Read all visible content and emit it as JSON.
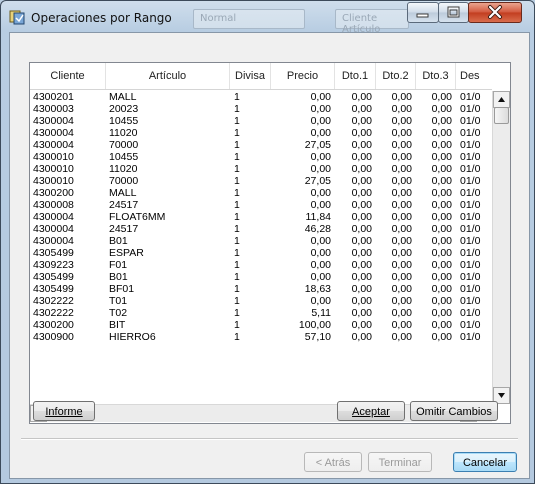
{
  "window": {
    "title": "Operaciones por Rango",
    "background_hint_1": "Normal",
    "background_hint_2": "Cliente Artículo"
  },
  "grid": {
    "columns": [
      "Cliente",
      "Artículo",
      "Divisa",
      "Precio",
      "Dto.1",
      "Dto.2",
      "Dto.3",
      "Desde"
    ],
    "columns_visible_text": [
      "Cliente",
      "Artículo",
      "Divisa",
      "Precio",
      "Dto.1",
      "Dto.2",
      "Dto.3",
      "Des"
    ],
    "rows": [
      [
        "4300201",
        "MALL",
        "1",
        "0,00",
        "0,00",
        "0,00",
        "0,00",
        "01/0"
      ],
      [
        "4300003",
        "20023",
        "1",
        "0,00",
        "0,00",
        "0,00",
        "0,00",
        "01/0"
      ],
      [
        "4300004",
        "10455",
        "1",
        "0,00",
        "0,00",
        "0,00",
        "0,00",
        "01/0"
      ],
      [
        "4300004",
        "11020",
        "1",
        "0,00",
        "0,00",
        "0,00",
        "0,00",
        "01/0"
      ],
      [
        "4300004",
        "70000",
        "1",
        "27,05",
        "0,00",
        "0,00",
        "0,00",
        "01/0"
      ],
      [
        "4300010",
        "10455",
        "1",
        "0,00",
        "0,00",
        "0,00",
        "0,00",
        "01/0"
      ],
      [
        "4300010",
        "11020",
        "1",
        "0,00",
        "0,00",
        "0,00",
        "0,00",
        "01/0"
      ],
      [
        "4300010",
        "70000",
        "1",
        "27,05",
        "0,00",
        "0,00",
        "0,00",
        "01/0"
      ],
      [
        "4300200",
        "MALL",
        "1",
        "0,00",
        "0,00",
        "0,00",
        "0,00",
        "01/0"
      ],
      [
        "4300008",
        "24517",
        "1",
        "0,00",
        "0,00",
        "0,00",
        "0,00",
        "01/0"
      ],
      [
        "4300004",
        "FLOAT6MM",
        "1",
        "11,84",
        "0,00",
        "0,00",
        "0,00",
        "01/0"
      ],
      [
        "4300004",
        "24517",
        "1",
        "46,28",
        "0,00",
        "0,00",
        "0,00",
        "01/0"
      ],
      [
        "4300004",
        "B01",
        "1",
        "0,00",
        "0,00",
        "0,00",
        "0,00",
        "01/0"
      ],
      [
        "4305499",
        "ESPAR",
        "1",
        "0,00",
        "0,00",
        "0,00",
        "0,00",
        "01/0"
      ],
      [
        "4309223",
        "F01",
        "1",
        "0,00",
        "0,00",
        "0,00",
        "0,00",
        "01/0"
      ],
      [
        "4305499",
        "B01",
        "1",
        "0,00",
        "0,00",
        "0,00",
        "0,00",
        "01/0"
      ],
      [
        "4305499",
        "BF01",
        "1",
        "18,63",
        "0,00",
        "0,00",
        "0,00",
        "01/0"
      ],
      [
        "4302222",
        "T01",
        "1",
        "0,00",
        "0,00",
        "0,00",
        "0,00",
        "01/0"
      ],
      [
        "4302222",
        "T02",
        "1",
        "5,11",
        "0,00",
        "0,00",
        "0,00",
        "01/0"
      ],
      [
        "4300200",
        "BIT",
        "1",
        "100,00",
        "0,00",
        "0,00",
        "0,00",
        "01/0"
      ],
      [
        "4300900",
        "HIERRO6",
        "1",
        "57,10",
        "0,00",
        "0,00",
        "0,00",
        "01/0"
      ]
    ]
  },
  "buttons": {
    "informe": "Informe",
    "aceptar": "Aceptar",
    "omitir": "Omitir Cambios",
    "atras": "< Atrás",
    "terminar": "Terminar",
    "cancelar": "Cancelar"
  },
  "icons": {
    "app": "app-icon",
    "minimize": "minimize-icon",
    "maximize": "maximize-icon",
    "close": "close-icon",
    "scroll_up": "up-arrow-icon",
    "scroll_down": "down-arrow-icon",
    "scroll_left": "left-arrow-icon",
    "scroll_right": "right-arrow-icon"
  },
  "colors": {
    "title_bar": "#c4d6e8",
    "close_button": "#c94a2c",
    "default_button": "#bee6fd"
  }
}
